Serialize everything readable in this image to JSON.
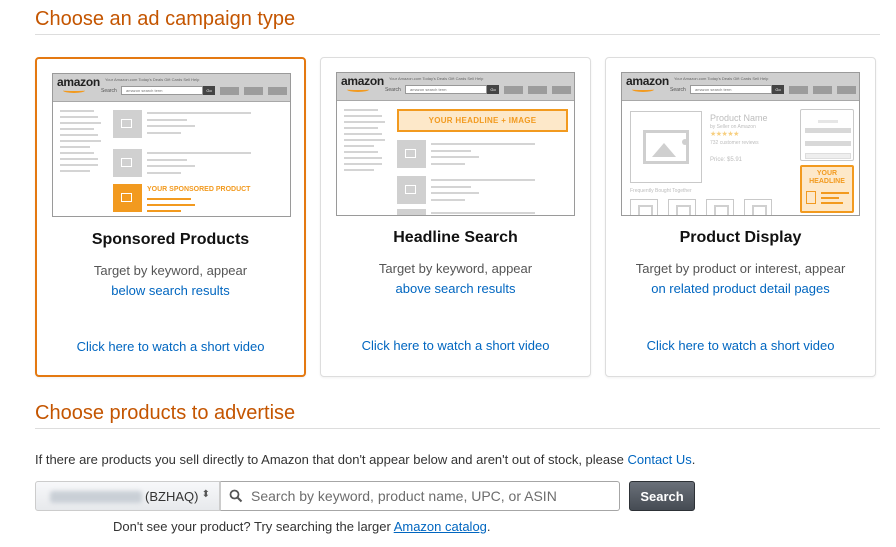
{
  "campaign_section": {
    "title": "Choose an ad campaign type",
    "cards": [
      {
        "name": "Sponsored Products",
        "selected": true,
        "desc": "Target by keyword, appear",
        "desc_link": "below search results",
        "video_link": "Click here to watch a short video",
        "preview_label": "YOUR SPONSORED PRODUCT"
      },
      {
        "name": "Headline Search",
        "selected": false,
        "desc": "Target by keyword, appear",
        "desc_link": "above search results",
        "video_link": "Click here to watch a short video",
        "preview_label": "YOUR HEADLINE + IMAGE"
      },
      {
        "name": "Product Display",
        "selected": false,
        "desc": "Target by product or interest, appear",
        "desc_link": "on related product detail pages",
        "video_link": "Click here to watch a short video",
        "preview_label": "YOUR HEADLINE"
      }
    ],
    "mock": {
      "logo": "amazon",
      "nav": "Your Amazon.com   Today's Deals   Gift Cards   Sell   Help",
      "search_label": "Search",
      "search_value": "amazon search term",
      "go": "Go",
      "product_name": "Product Name",
      "seller": "by Seller on Amazon",
      "stars": "★★★★★",
      "reviews": "732 customer reviews",
      "price": "Price: $5.91",
      "fbt": "Frequently Bought Together"
    }
  },
  "products_section": {
    "title": "Choose products to advertise",
    "info_text": "If there are products you sell directly to Amazon that don't appear below and aren't out of stock, please ",
    "contact_link": "Contact Us",
    "info_end": ".",
    "seller_select": {
      "value_suffix": "(BZHAQ)",
      "arrows": "⬍"
    },
    "search": {
      "placeholder": "Search by keyword, product name, UPC, or ASIN",
      "value": "",
      "button": "Search"
    },
    "hint_text": "Don't see your product? Try searching the larger ",
    "catalog_link": "Amazon catalog",
    "hint_end": "."
  },
  "colors": {
    "accent_orange": "#e47911",
    "title_orange": "#c45500",
    "link_blue": "#0066c0"
  }
}
